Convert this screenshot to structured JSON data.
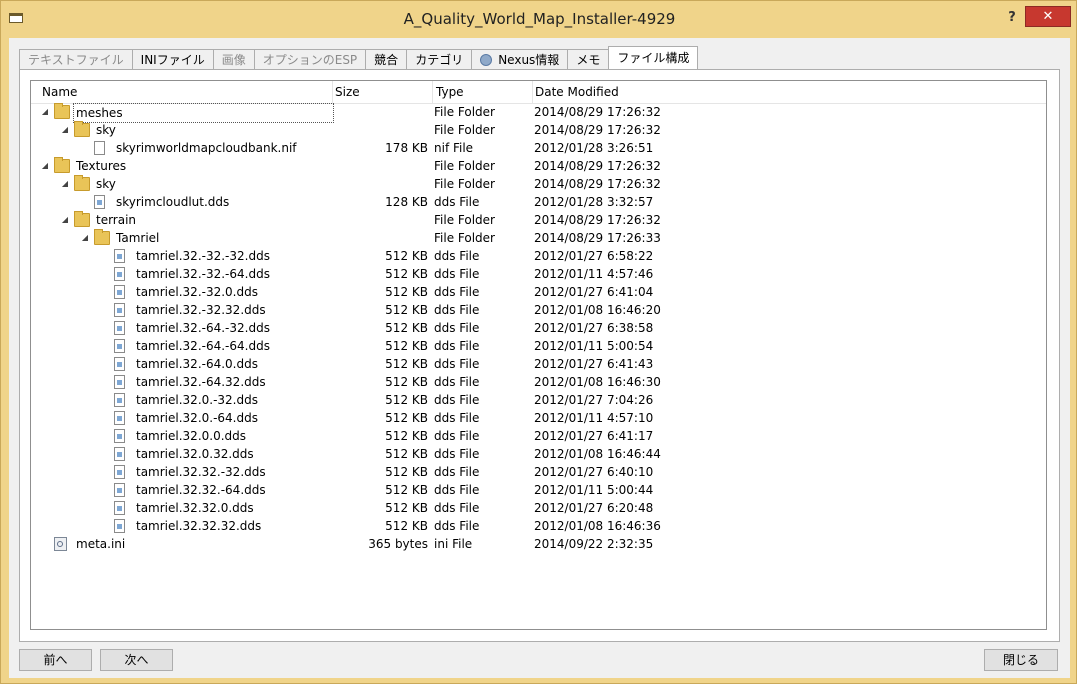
{
  "window": {
    "title": "A_Quality_World_Map_Installer-4929",
    "help_label": "?",
    "close_label": "✕"
  },
  "tabs": [
    {
      "label": "テキストファイル",
      "enabled": false,
      "active": false
    },
    {
      "label": "INIファイル",
      "enabled": true,
      "active": false
    },
    {
      "label": "画像",
      "enabled": false,
      "active": false
    },
    {
      "label": "オプションのESP",
      "enabled": false,
      "active": false
    },
    {
      "label": "競合",
      "enabled": true,
      "active": false
    },
    {
      "label": "カテゴリ",
      "enabled": true,
      "active": false
    },
    {
      "label": "Nexus情報",
      "enabled": true,
      "active": false,
      "icon": "nexus-globe-icon"
    },
    {
      "label": "メモ",
      "enabled": true,
      "active": false
    },
    {
      "label": "ファイル構成",
      "enabled": true,
      "active": true
    }
  ],
  "columns": {
    "name": "Name",
    "size": "Size",
    "type": "Type",
    "date": "Date Modified"
  },
  "rows": [
    {
      "name": "meshes",
      "level": 0,
      "toggle": "◢",
      "icon": "folder-icon",
      "size": "",
      "type": "File Folder",
      "date": "2014/08/29 17:26:32",
      "selected": true
    },
    {
      "name": "sky",
      "level": 1,
      "toggle": "◢",
      "icon": "folder-icon",
      "size": "",
      "type": "File Folder",
      "date": "2014/08/29 17:26:32"
    },
    {
      "name": "skyrimworldmapcloudbank.nif",
      "level": 2,
      "toggle": "",
      "icon": "file-icon",
      "size": "178 KB",
      "type": "nif File",
      "date": "2012/01/28 3:26:51"
    },
    {
      "name": "Textures",
      "level": 0,
      "toggle": "◢",
      "icon": "folder-icon",
      "size": "",
      "type": "File Folder",
      "date": "2014/08/29 17:26:32"
    },
    {
      "name": "sky",
      "level": 1,
      "toggle": "◢",
      "icon": "folder-icon",
      "size": "",
      "type": "File Folder",
      "date": "2014/08/29 17:26:32"
    },
    {
      "name": "skyrimcloudlut.dds",
      "level": 2,
      "toggle": "",
      "icon": "dds-file-icon",
      "size": "128 KB",
      "type": "dds File",
      "date": "2012/01/28 3:32:57"
    },
    {
      "name": "terrain",
      "level": 1,
      "toggle": "◢",
      "icon": "folder-icon",
      "size": "",
      "type": "File Folder",
      "date": "2014/08/29 17:26:32"
    },
    {
      "name": "Tamriel",
      "level": 2,
      "toggle": "◢",
      "icon": "folder-icon",
      "size": "",
      "type": "File Folder",
      "date": "2014/08/29 17:26:33"
    },
    {
      "name": "tamriel.32.-32.-32.dds",
      "level": 3,
      "toggle": "",
      "icon": "dds-file-icon",
      "size": "512 KB",
      "type": "dds File",
      "date": "2012/01/27 6:58:22"
    },
    {
      "name": "tamriel.32.-32.-64.dds",
      "level": 3,
      "toggle": "",
      "icon": "dds-file-icon",
      "size": "512 KB",
      "type": "dds File",
      "date": "2012/01/11 4:57:46"
    },
    {
      "name": "tamriel.32.-32.0.dds",
      "level": 3,
      "toggle": "",
      "icon": "dds-file-icon",
      "size": "512 KB",
      "type": "dds File",
      "date": "2012/01/27 6:41:04"
    },
    {
      "name": "tamriel.32.-32.32.dds",
      "level": 3,
      "toggle": "",
      "icon": "dds-file-icon",
      "size": "512 KB",
      "type": "dds File",
      "date": "2012/01/08 16:46:20"
    },
    {
      "name": "tamriel.32.-64.-32.dds",
      "level": 3,
      "toggle": "",
      "icon": "dds-file-icon",
      "size": "512 KB",
      "type": "dds File",
      "date": "2012/01/27 6:38:58"
    },
    {
      "name": "tamriel.32.-64.-64.dds",
      "level": 3,
      "toggle": "",
      "icon": "dds-file-icon",
      "size": "512 KB",
      "type": "dds File",
      "date": "2012/01/11 5:00:54"
    },
    {
      "name": "tamriel.32.-64.0.dds",
      "level": 3,
      "toggle": "",
      "icon": "dds-file-icon",
      "size": "512 KB",
      "type": "dds File",
      "date": "2012/01/27 6:41:43"
    },
    {
      "name": "tamriel.32.-64.32.dds",
      "level": 3,
      "toggle": "",
      "icon": "dds-file-icon",
      "size": "512 KB",
      "type": "dds File",
      "date": "2012/01/08 16:46:30"
    },
    {
      "name": "tamriel.32.0.-32.dds",
      "level": 3,
      "toggle": "",
      "icon": "dds-file-icon",
      "size": "512 KB",
      "type": "dds File",
      "date": "2012/01/27 7:04:26"
    },
    {
      "name": "tamriel.32.0.-64.dds",
      "level": 3,
      "toggle": "",
      "icon": "dds-file-icon",
      "size": "512 KB",
      "type": "dds File",
      "date": "2012/01/11 4:57:10"
    },
    {
      "name": "tamriel.32.0.0.dds",
      "level": 3,
      "toggle": "",
      "icon": "dds-file-icon",
      "size": "512 KB",
      "type": "dds File",
      "date": "2012/01/27 6:41:17"
    },
    {
      "name": "tamriel.32.0.32.dds",
      "level": 3,
      "toggle": "",
      "icon": "dds-file-icon",
      "size": "512 KB",
      "type": "dds File",
      "date": "2012/01/08 16:46:44"
    },
    {
      "name": "tamriel.32.32.-32.dds",
      "level": 3,
      "toggle": "",
      "icon": "dds-file-icon",
      "size": "512 KB",
      "type": "dds File",
      "date": "2012/01/27 6:40:10"
    },
    {
      "name": "tamriel.32.32.-64.dds",
      "level": 3,
      "toggle": "",
      "icon": "dds-file-icon",
      "size": "512 KB",
      "type": "dds File",
      "date": "2012/01/11 5:00:44"
    },
    {
      "name": "tamriel.32.32.0.dds",
      "level": 3,
      "toggle": "",
      "icon": "dds-file-icon",
      "size": "512 KB",
      "type": "dds File",
      "date": "2012/01/27 6:20:48"
    },
    {
      "name": "tamriel.32.32.32.dds",
      "level": 3,
      "toggle": "",
      "icon": "dds-file-icon",
      "size": "512 KB",
      "type": "dds File",
      "date": "2012/01/08 16:46:36"
    },
    {
      "name": "meta.ini",
      "level": 0,
      "toggle": "",
      "icon": "ini-file-icon",
      "size": "365 bytes",
      "type": "ini File",
      "date": "2014/09/22 2:32:35"
    }
  ],
  "footer": {
    "prev_label": "前へ",
    "next_label": "次へ",
    "close_label": "閉じる"
  }
}
